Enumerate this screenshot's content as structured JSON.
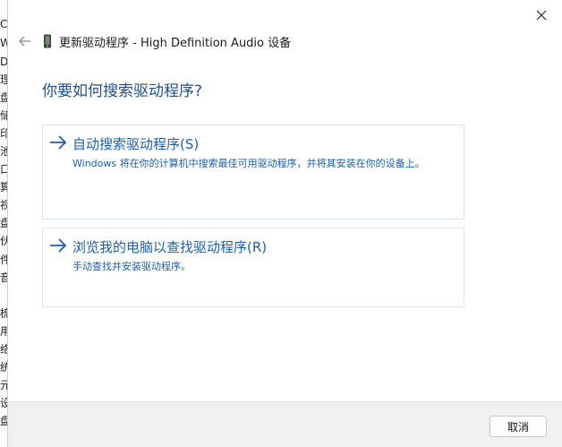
{
  "background_window": {
    "fragments": [
      "CT",
      "W",
      "DE",
      "理",
      "盘",
      "储",
      "印",
      "池",
      "口",
      "算",
      "视",
      "盘",
      "伙",
      "件",
      "音",
      "梳",
      "用",
      "络",
      "统",
      "元",
      "设",
      "盘"
    ]
  },
  "dialog": {
    "title": "更新驱动程序 - High Definition Audio 设备",
    "question": "你要如何搜索驱动程序?",
    "options": [
      {
        "title": "自动搜索驱动程序(S)",
        "description": "Windows 将在你的计算机中搜索最佳可用驱动程序，并将其安装在你的设备上。"
      },
      {
        "title": "浏览我的电脑以查找驱动程序(R)",
        "description": "手动查找并安装驱动程序。"
      }
    ],
    "cancel_label": "取消"
  },
  "colors": {
    "accent": "#1a5fb4",
    "question": "#1e4f91"
  },
  "icons": [
    "close-icon",
    "back-arrow-icon",
    "device-icon",
    "right-arrow-icon"
  ]
}
